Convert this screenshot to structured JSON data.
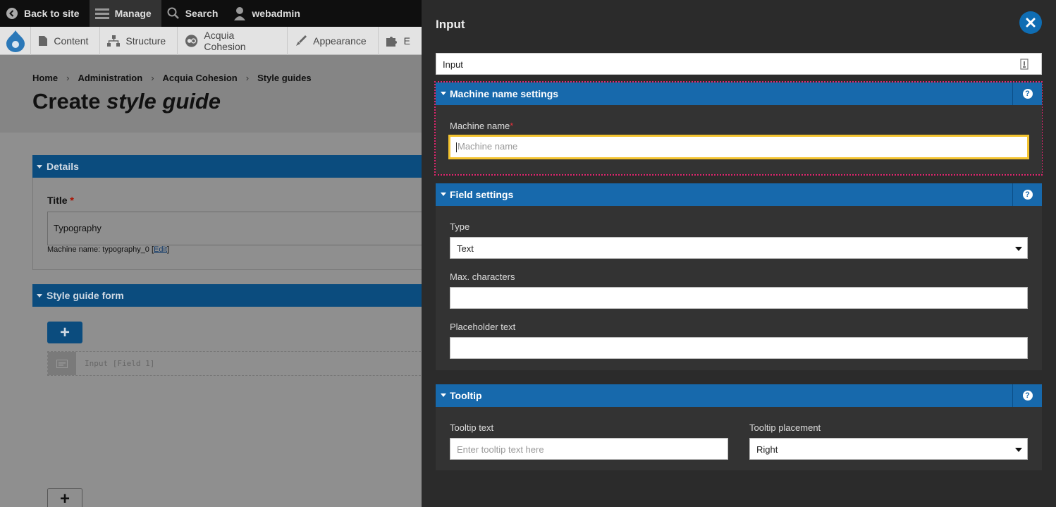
{
  "toolbar": {
    "back_label": "Back to site",
    "manage_label": "Manage",
    "search_label": "Search",
    "user_label": "webadmin"
  },
  "tray": {
    "items": [
      "Content",
      "Structure",
      "Acquia Cohesion",
      "Appearance",
      "E"
    ]
  },
  "breadcrumb": [
    "Home",
    "Administration",
    "Acquia Cohesion",
    "Style guides"
  ],
  "page": {
    "title_prefix": "Create ",
    "title_em": "style guide"
  },
  "details": {
    "header": "Details",
    "title_label": "Title",
    "required_mark": "*",
    "title_value": "Typography",
    "machine_prefix": "Machine name: typography_0 [",
    "machine_edit": "Edit",
    "machine_suffix": "]"
  },
  "style_form": {
    "header": "Style guide form",
    "add_symbol": "+",
    "field_text": "Input [Field 1]"
  },
  "modal": {
    "title": "Input",
    "name_value": "Input",
    "machine_section": {
      "header": "Machine name settings",
      "label": "Machine name",
      "required_mark": "*",
      "placeholder": "Machine name"
    },
    "field_section": {
      "header": "Field settings",
      "type_label": "Type",
      "type_value": "Text",
      "max_label": "Max. characters",
      "max_value": "",
      "placeholder_label": "Placeholder text",
      "placeholder_value": ""
    },
    "tooltip_section": {
      "header": "Tooltip",
      "text_label": "Tooltip text",
      "text_placeholder": "Enter tooltip text here",
      "placement_label": "Tooltip placement",
      "placement_value": "Right"
    },
    "help_symbol": "?"
  },
  "colors": {
    "accent_blue": "#1769ac",
    "highlight_pink": "#e0266e",
    "focus_yellow": "#f4c430",
    "modal_bg": "#2b2b2b"
  }
}
